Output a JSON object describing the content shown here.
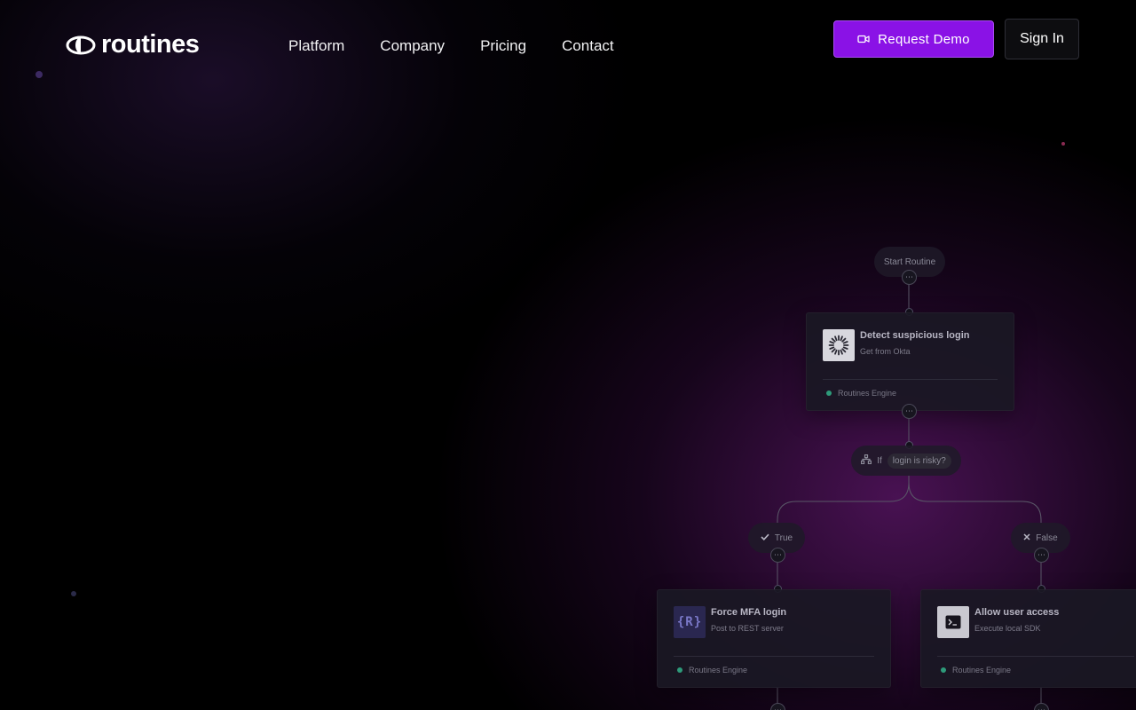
{
  "brand": {
    "name": "routines",
    "accent": "#8a12e6"
  },
  "nav": {
    "items": [
      "Platform",
      "Company",
      "Pricing",
      "Contact"
    ]
  },
  "header": {
    "demo_label": "Request Demo",
    "demo_icon": "video-camera-icon",
    "signin_label": "Sign In"
  },
  "flow": {
    "start": "Start Routine",
    "detect": {
      "title": "Detect suspicious login",
      "subtitle": "Get from Okta",
      "engine": "Routines Engine",
      "icon": "okta-logo-icon"
    },
    "condition": {
      "prefix": "If",
      "expression": "login is risky?",
      "icon": "branch-icon"
    },
    "true_label": "True",
    "false_label": "False",
    "mfa": {
      "title": "Force MFA login",
      "subtitle": "Post to REST server",
      "engine": "Routines Engine",
      "icon_text": "{R}"
    },
    "allow": {
      "title": "Allow user access",
      "subtitle": "Execute local SDK",
      "engine": "Routines Engine",
      "icon": "terminal-icon"
    },
    "more_glyph": "⋯"
  }
}
